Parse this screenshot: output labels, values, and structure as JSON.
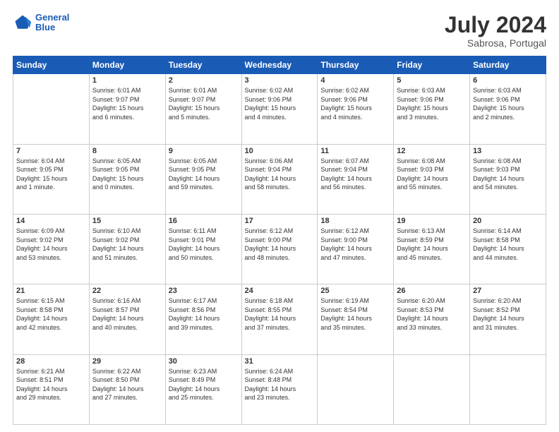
{
  "header": {
    "logo_line1": "General",
    "logo_line2": "Blue",
    "title": "July 2024",
    "subtitle": "Sabrosa, Portugal"
  },
  "days_of_week": [
    "Sunday",
    "Monday",
    "Tuesday",
    "Wednesday",
    "Thursday",
    "Friday",
    "Saturday"
  ],
  "weeks": [
    [
      {
        "num": "",
        "info": ""
      },
      {
        "num": "1",
        "info": "Sunrise: 6:01 AM\nSunset: 9:07 PM\nDaylight: 15 hours\nand 6 minutes."
      },
      {
        "num": "2",
        "info": "Sunrise: 6:01 AM\nSunset: 9:07 PM\nDaylight: 15 hours\nand 5 minutes."
      },
      {
        "num": "3",
        "info": "Sunrise: 6:02 AM\nSunset: 9:06 PM\nDaylight: 15 hours\nand 4 minutes."
      },
      {
        "num": "4",
        "info": "Sunrise: 6:02 AM\nSunset: 9:06 PM\nDaylight: 15 hours\nand 4 minutes."
      },
      {
        "num": "5",
        "info": "Sunrise: 6:03 AM\nSunset: 9:06 PM\nDaylight: 15 hours\nand 3 minutes."
      },
      {
        "num": "6",
        "info": "Sunrise: 6:03 AM\nSunset: 9:06 PM\nDaylight: 15 hours\nand 2 minutes."
      }
    ],
    [
      {
        "num": "7",
        "info": "Sunrise: 6:04 AM\nSunset: 9:05 PM\nDaylight: 15 hours\nand 1 minute."
      },
      {
        "num": "8",
        "info": "Sunrise: 6:05 AM\nSunset: 9:05 PM\nDaylight: 15 hours\nand 0 minutes."
      },
      {
        "num": "9",
        "info": "Sunrise: 6:05 AM\nSunset: 9:05 PM\nDaylight: 14 hours\nand 59 minutes."
      },
      {
        "num": "10",
        "info": "Sunrise: 6:06 AM\nSunset: 9:04 PM\nDaylight: 14 hours\nand 58 minutes."
      },
      {
        "num": "11",
        "info": "Sunrise: 6:07 AM\nSunset: 9:04 PM\nDaylight: 14 hours\nand 56 minutes."
      },
      {
        "num": "12",
        "info": "Sunrise: 6:08 AM\nSunset: 9:03 PM\nDaylight: 14 hours\nand 55 minutes."
      },
      {
        "num": "13",
        "info": "Sunrise: 6:08 AM\nSunset: 9:03 PM\nDaylight: 14 hours\nand 54 minutes."
      }
    ],
    [
      {
        "num": "14",
        "info": "Sunrise: 6:09 AM\nSunset: 9:02 PM\nDaylight: 14 hours\nand 53 minutes."
      },
      {
        "num": "15",
        "info": "Sunrise: 6:10 AM\nSunset: 9:02 PM\nDaylight: 14 hours\nand 51 minutes."
      },
      {
        "num": "16",
        "info": "Sunrise: 6:11 AM\nSunset: 9:01 PM\nDaylight: 14 hours\nand 50 minutes."
      },
      {
        "num": "17",
        "info": "Sunrise: 6:12 AM\nSunset: 9:00 PM\nDaylight: 14 hours\nand 48 minutes."
      },
      {
        "num": "18",
        "info": "Sunrise: 6:12 AM\nSunset: 9:00 PM\nDaylight: 14 hours\nand 47 minutes."
      },
      {
        "num": "19",
        "info": "Sunrise: 6:13 AM\nSunset: 8:59 PM\nDaylight: 14 hours\nand 45 minutes."
      },
      {
        "num": "20",
        "info": "Sunrise: 6:14 AM\nSunset: 8:58 PM\nDaylight: 14 hours\nand 44 minutes."
      }
    ],
    [
      {
        "num": "21",
        "info": "Sunrise: 6:15 AM\nSunset: 8:58 PM\nDaylight: 14 hours\nand 42 minutes."
      },
      {
        "num": "22",
        "info": "Sunrise: 6:16 AM\nSunset: 8:57 PM\nDaylight: 14 hours\nand 40 minutes."
      },
      {
        "num": "23",
        "info": "Sunrise: 6:17 AM\nSunset: 8:56 PM\nDaylight: 14 hours\nand 39 minutes."
      },
      {
        "num": "24",
        "info": "Sunrise: 6:18 AM\nSunset: 8:55 PM\nDaylight: 14 hours\nand 37 minutes."
      },
      {
        "num": "25",
        "info": "Sunrise: 6:19 AM\nSunset: 8:54 PM\nDaylight: 14 hours\nand 35 minutes."
      },
      {
        "num": "26",
        "info": "Sunrise: 6:20 AM\nSunset: 8:53 PM\nDaylight: 14 hours\nand 33 minutes."
      },
      {
        "num": "27",
        "info": "Sunrise: 6:20 AM\nSunset: 8:52 PM\nDaylight: 14 hours\nand 31 minutes."
      }
    ],
    [
      {
        "num": "28",
        "info": "Sunrise: 6:21 AM\nSunset: 8:51 PM\nDaylight: 14 hours\nand 29 minutes."
      },
      {
        "num": "29",
        "info": "Sunrise: 6:22 AM\nSunset: 8:50 PM\nDaylight: 14 hours\nand 27 minutes."
      },
      {
        "num": "30",
        "info": "Sunrise: 6:23 AM\nSunset: 8:49 PM\nDaylight: 14 hours\nand 25 minutes."
      },
      {
        "num": "31",
        "info": "Sunrise: 6:24 AM\nSunset: 8:48 PM\nDaylight: 14 hours\nand 23 minutes."
      },
      {
        "num": "",
        "info": ""
      },
      {
        "num": "",
        "info": ""
      },
      {
        "num": "",
        "info": ""
      }
    ]
  ]
}
